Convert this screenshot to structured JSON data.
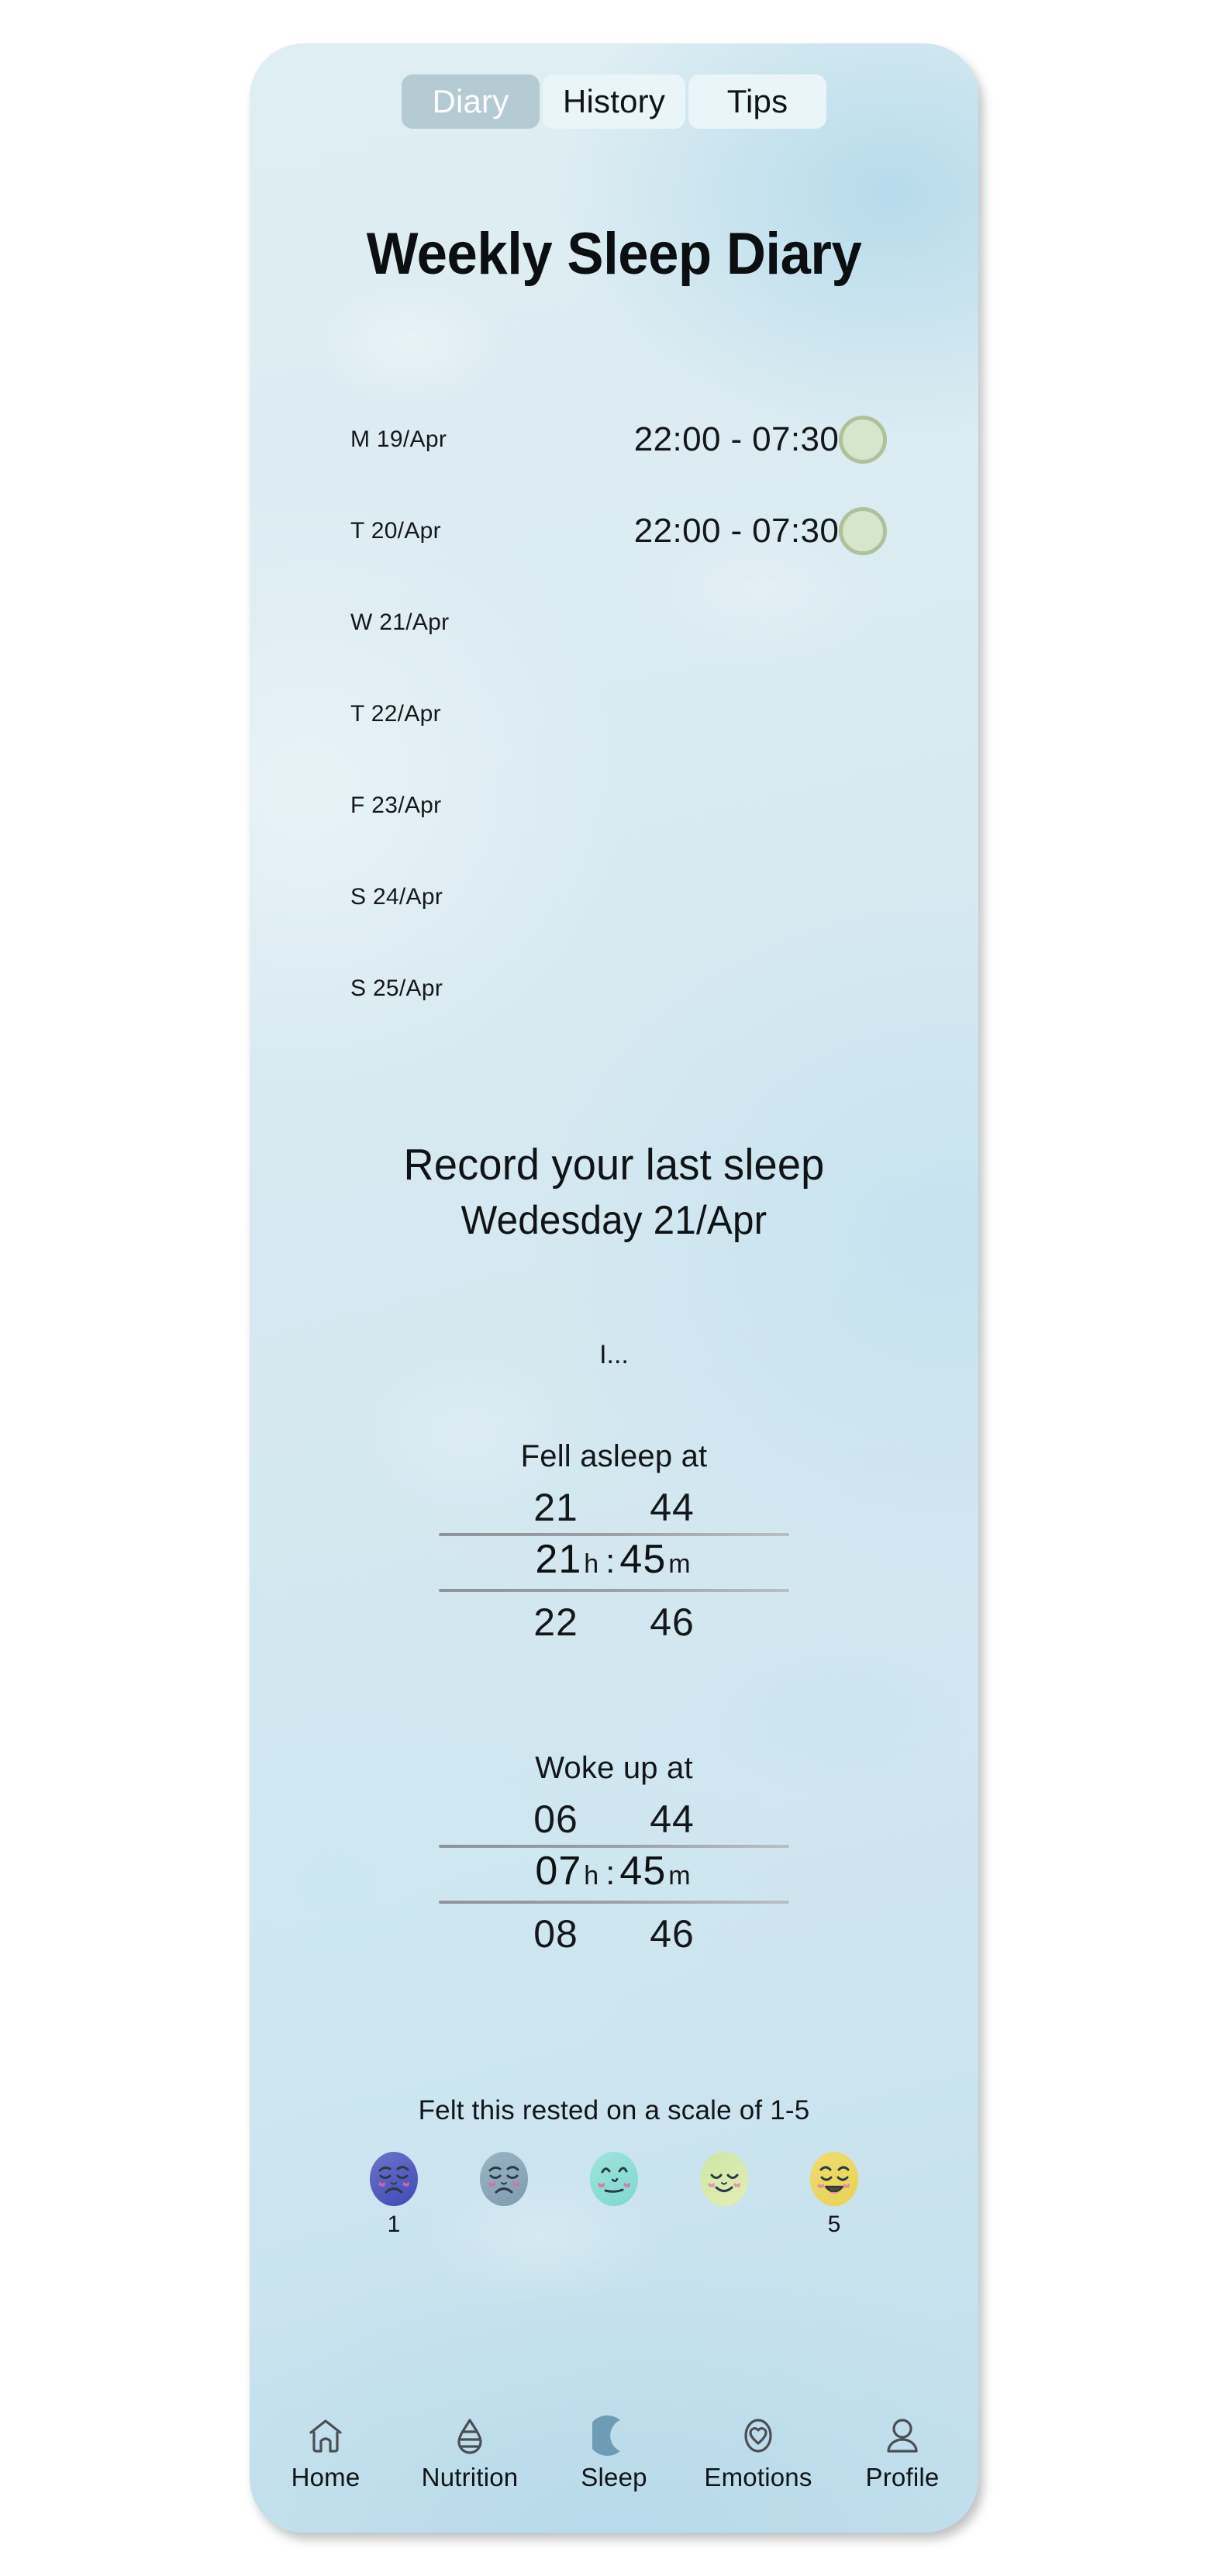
{
  "app": {
    "title": "Weekly Sleep Diary"
  },
  "tabs": {
    "items": [
      {
        "label": "Diary",
        "active": true
      },
      {
        "label": "History",
        "active": false
      },
      {
        "label": "Tips",
        "active": false
      }
    ]
  },
  "week": {
    "rows": [
      {
        "day": "M 19/Apr",
        "range": "22:00 - 07:30",
        "dot": true
      },
      {
        "day": "T 20/Apr",
        "range": "22:00 - 07:30",
        "dot": true
      },
      {
        "day": "W 21/Apr",
        "range": "",
        "dot": false
      },
      {
        "day": "T 22/Apr",
        "range": "",
        "dot": false
      },
      {
        "day": "F 23/Apr",
        "range": "",
        "dot": false
      },
      {
        "day": "S 24/Apr",
        "range": "",
        "dot": false
      },
      {
        "day": "S 25/Apr",
        "range": "",
        "dot": false
      }
    ]
  },
  "record": {
    "heading": "Record your last sleep",
    "date": "Wedesday 21/Apr",
    "note": "I..."
  },
  "fell_asleep": {
    "title": "Fell asleep at",
    "prev_hour": "21",
    "prev_minute": "44",
    "hour": "21",
    "minute": "45",
    "hour_unit": "h",
    "separator": ":",
    "minute_unit": "m",
    "next_hour": "22",
    "next_minute": "46"
  },
  "woke_up": {
    "title": "Woke up at",
    "prev_hour": "06",
    "prev_minute": "44",
    "hour": "07",
    "minute": "45",
    "hour_unit": "h",
    "separator": ":",
    "minute_unit": "m",
    "next_hour": "08",
    "next_minute": "46"
  },
  "rating": {
    "label": "Felt this rested on a scale of 1-5",
    "faces": [
      {
        "value": "1",
        "show_number": true,
        "color_a": "#6b74c9",
        "color_b": "#3f49b5",
        "mood": "very-sad"
      },
      {
        "value": "2",
        "show_number": false,
        "color_a": "#9ab4c4",
        "color_b": "#7e9bae",
        "mood": "sad"
      },
      {
        "value": "3",
        "show_number": false,
        "color_a": "#9fe3dc",
        "color_b": "#7fd8cf",
        "mood": "neutral"
      },
      {
        "value": "4",
        "show_number": false,
        "color_a": "#cde6a8",
        "color_b": "#e4eeb4",
        "mood": "content"
      },
      {
        "value": "5",
        "show_number": true,
        "color_a": "#f0dc6e",
        "color_b": "#e8d254",
        "mood": "happy"
      }
    ]
  },
  "nav": {
    "items": [
      {
        "label": "Home",
        "icon": "house-icon",
        "active": false
      },
      {
        "label": "Nutrition",
        "icon": "droplet-icon",
        "active": false
      },
      {
        "label": "Sleep",
        "icon": "moon-icon",
        "active": true
      },
      {
        "label": "Emotions",
        "icon": "heart-icon",
        "active": false
      },
      {
        "label": "Profile",
        "icon": "person-icon",
        "active": false
      }
    ]
  },
  "colors": {
    "tab_active_bg": "#b4cbd3",
    "tab_inactive_bg": "#e9f5f9",
    "dot_fill": "#d5e6cc",
    "dot_border": "#aec19c",
    "moon_active": "#6e9cb4",
    "icon_stroke": "#4a4f54",
    "text": "#101316"
  }
}
